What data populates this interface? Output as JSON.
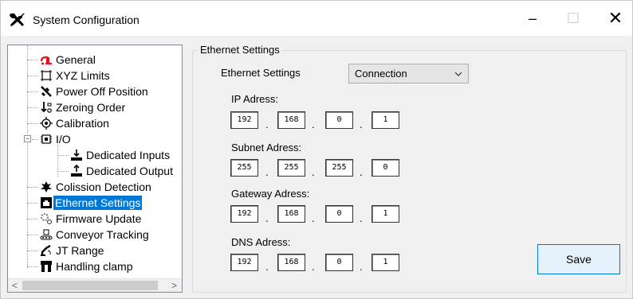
{
  "window": {
    "title": "System Configuration",
    "controls": {
      "minimize": "–",
      "maximize": "☐",
      "close": "✕"
    }
  },
  "tree": {
    "items": [
      {
        "label": "General",
        "icon": "general-icon"
      },
      {
        "label": "XYZ Limits",
        "icon": "xyz-limits-icon"
      },
      {
        "label": "Power Off Position",
        "icon": "power-off-position-icon"
      },
      {
        "label": "Zeroing Order",
        "icon": "zeroing-order-icon"
      },
      {
        "label": "Calibration",
        "icon": "calibration-icon"
      },
      {
        "label": "I/O",
        "icon": "io-icon",
        "expanded": true
      },
      {
        "label": "Dedicated Inputs",
        "icon": "dedicated-inputs-icon",
        "child": true
      },
      {
        "label": "Dedicated Output",
        "icon": "dedicated-output-icon",
        "child": true
      },
      {
        "label": "Colission Detection",
        "icon": "collision-detection-icon"
      },
      {
        "label": "Ethernet Settings",
        "icon": "ethernet-settings-icon",
        "selected": true
      },
      {
        "label": "Firmware Update",
        "icon": "firmware-update-icon"
      },
      {
        "label": "Conveyor Tracking",
        "icon": "conveyor-tracking-icon"
      },
      {
        "label": "JT Range",
        "icon": "jt-range-icon"
      },
      {
        "label": "Handling clamp",
        "icon": "handling-clamp-icon"
      }
    ],
    "expander_symbol": "−",
    "scroll_left": "<",
    "scroll_right": ">"
  },
  "ethernet": {
    "group_title": "Ethernet Settings",
    "settings_label": "Ethernet Settings",
    "settings_value": "Connection",
    "ip": {
      "label": "IP Adress:",
      "octets": [
        "192",
        "168",
        "0",
        "1"
      ]
    },
    "subnet": {
      "label": "Subnet Adress:",
      "octets": [
        "255",
        "255",
        "255",
        "0"
      ]
    },
    "gateway": {
      "label": "Gateway Adress:",
      "octets": [
        "192",
        "168",
        "0",
        "1"
      ]
    },
    "dns": {
      "label": "DNS Adress:",
      "octets": [
        "192",
        "168",
        "0",
        "1"
      ]
    },
    "separator": ".",
    "save_label": "Save"
  },
  "colors": {
    "selection": "#0078d7",
    "accent_red": "#e81123",
    "button_face": "#e5f1fb"
  }
}
